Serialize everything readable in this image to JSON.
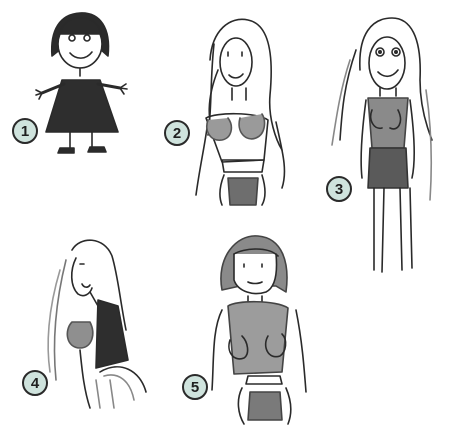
{
  "badges": [
    {
      "label": "1"
    },
    {
      "label": "2"
    },
    {
      "label": "3"
    },
    {
      "label": "4"
    },
    {
      "label": "5"
    }
  ],
  "colors": {
    "badge_fill": "#cfe3dd",
    "ink": "#2a2a2a",
    "shade": "#7a7a7a"
  }
}
